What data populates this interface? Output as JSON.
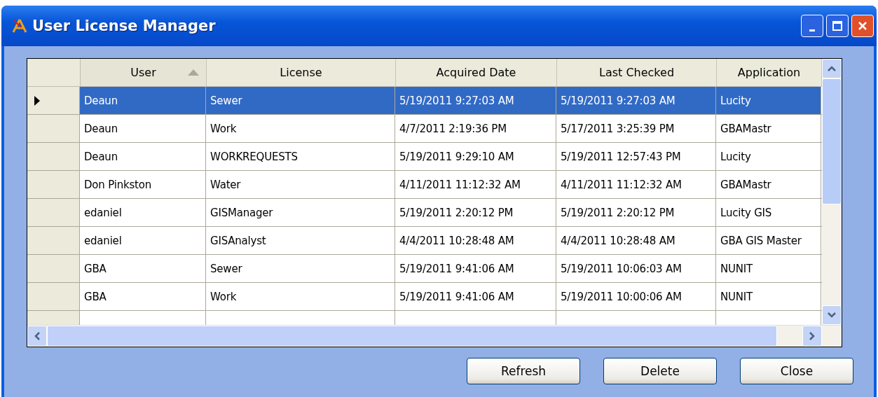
{
  "window": {
    "title": "User License Manager"
  },
  "table": {
    "columns": [
      {
        "label": "User",
        "sorted": true
      },
      {
        "label": "License",
        "sorted": false
      },
      {
        "label": "Acquired Date",
        "sorted": false
      },
      {
        "label": "Last Checked",
        "sorted": false
      },
      {
        "label": "Application",
        "sorted": false
      }
    ],
    "rows": [
      {
        "selected": true,
        "cells": [
          "Deaun",
          "Sewer",
          "5/19/2011 9:27:03 AM",
          "5/19/2011 9:27:03 AM",
          "Lucity"
        ]
      },
      {
        "selected": false,
        "cells": [
          "Deaun",
          "Work",
          "4/7/2011 2:19:36 PM",
          "5/17/2011 3:25:39 PM",
          "GBAMastr"
        ]
      },
      {
        "selected": false,
        "cells": [
          "Deaun",
          "WORKREQUESTS",
          "5/19/2011 9:29:10 AM",
          "5/19/2011 12:57:43 PM",
          "Lucity"
        ]
      },
      {
        "selected": false,
        "cells": [
          "Don Pinkston",
          "Water",
          "4/11/2011 11:12:32 AM",
          "4/11/2011 11:12:32 AM",
          "GBAMastr"
        ]
      },
      {
        "selected": false,
        "cells": [
          "edaniel",
          "GISManager",
          "5/19/2011 2:20:12 PM",
          "5/19/2011 2:20:12 PM",
          "Lucity GIS"
        ]
      },
      {
        "selected": false,
        "cells": [
          "edaniel",
          "GISAnalyst",
          "4/4/2011 10:28:48 AM",
          "4/4/2011 10:28:48 AM",
          "GBA GIS Master"
        ]
      },
      {
        "selected": false,
        "cells": [
          "GBA",
          "Sewer",
          "5/19/2011 9:41:06 AM",
          "5/19/2011 10:06:03 AM",
          "NUNIT"
        ]
      },
      {
        "selected": false,
        "cells": [
          "GBA",
          "Work",
          "5/19/2011 9:41:06 AM",
          "5/19/2011 10:00:06 AM",
          "NUNIT"
        ]
      }
    ]
  },
  "buttons": [
    "Refresh",
    "Delete",
    "Close"
  ]
}
